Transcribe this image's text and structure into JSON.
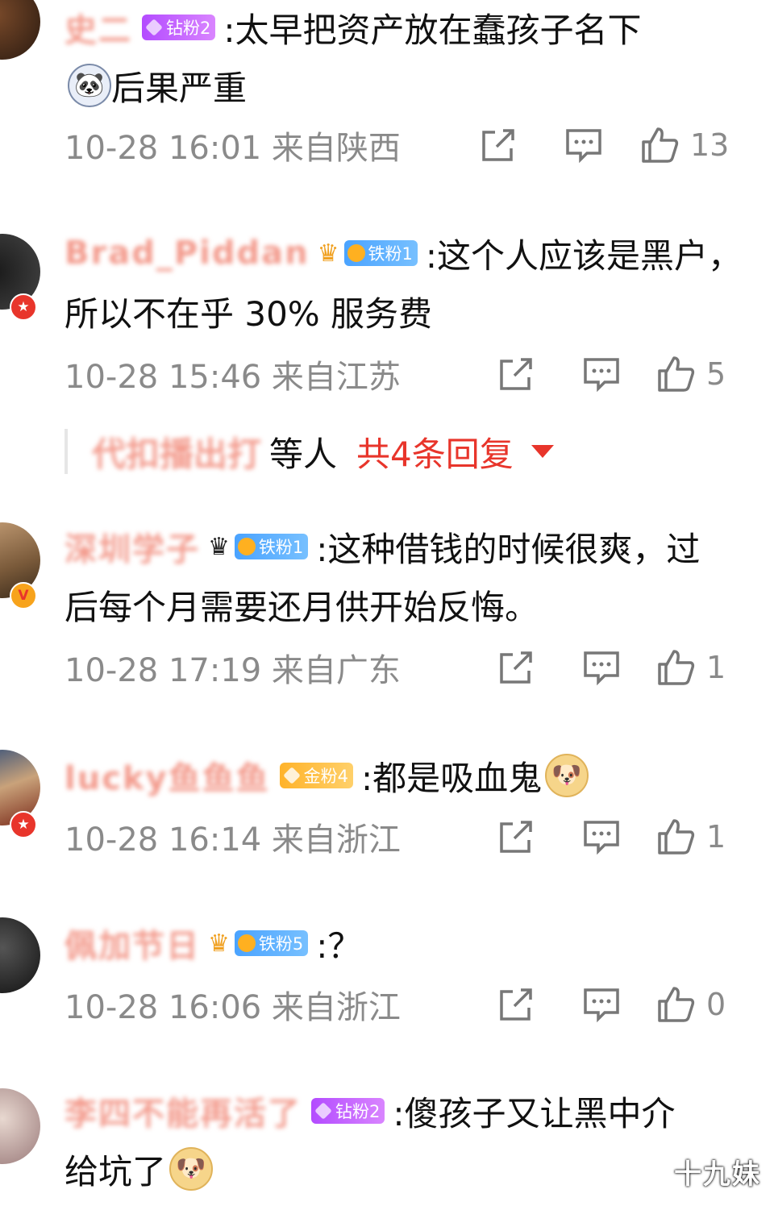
{
  "comments": [
    {
      "username": "史二",
      "fan_badge": "钻粉2",
      "text_line1": ":太早把资产放在蠢孩子名下",
      "text_line2": "后果严重",
      "meta": "10-28 16:01 来自陕西",
      "likes": "13"
    },
    {
      "username": "Brad_Piddan",
      "fan_badge": "铁粉1",
      "text_line1": ":这个人应该是黑户，",
      "text_line2": "所以不在乎 30% 服务费",
      "meta": "10-28 15:46 来自江苏",
      "likes": "5"
    },
    {
      "username": "深圳学子",
      "fan_badge": "铁粉1",
      "text_line1": ":这种借钱的时候很爽，过",
      "text_line2": "后每个月需要还月供开始反悔。",
      "meta": "10-28 17:19 来自广东",
      "likes": "1"
    },
    {
      "username": "lucky鱼鱼鱼",
      "fan_badge": "金粉4",
      "text_line1": ":都是吸血鬼",
      "meta": "10-28 16:14 来自浙江",
      "likes": "1"
    },
    {
      "username": "佩加节日",
      "fan_badge": "铁粉5",
      "text_line1": ":？",
      "meta": "10-28 16:06 来自浙江",
      "likes": "0"
    },
    {
      "username": "李四不能再活了",
      "fan_badge": "钻粉2",
      "text_line1": ":傻孩子又让黑中介",
      "text_line2": "给坑了"
    }
  ],
  "replies": {
    "user": "代扣播出打",
    "etc": "等人",
    "total": "共4条回复"
  },
  "icons": {
    "share": "share-icon",
    "comment": "comment-icon",
    "like": "thumbs-up-icon"
  },
  "watermark": "十九妹",
  "colors": {
    "accent_red": "#e8352b",
    "meta_gray": "#8a8a8a",
    "diamond_badge": "#b34bff",
    "iron_badge": "#4aa3ff",
    "gold_badge": "#ffb32a"
  }
}
